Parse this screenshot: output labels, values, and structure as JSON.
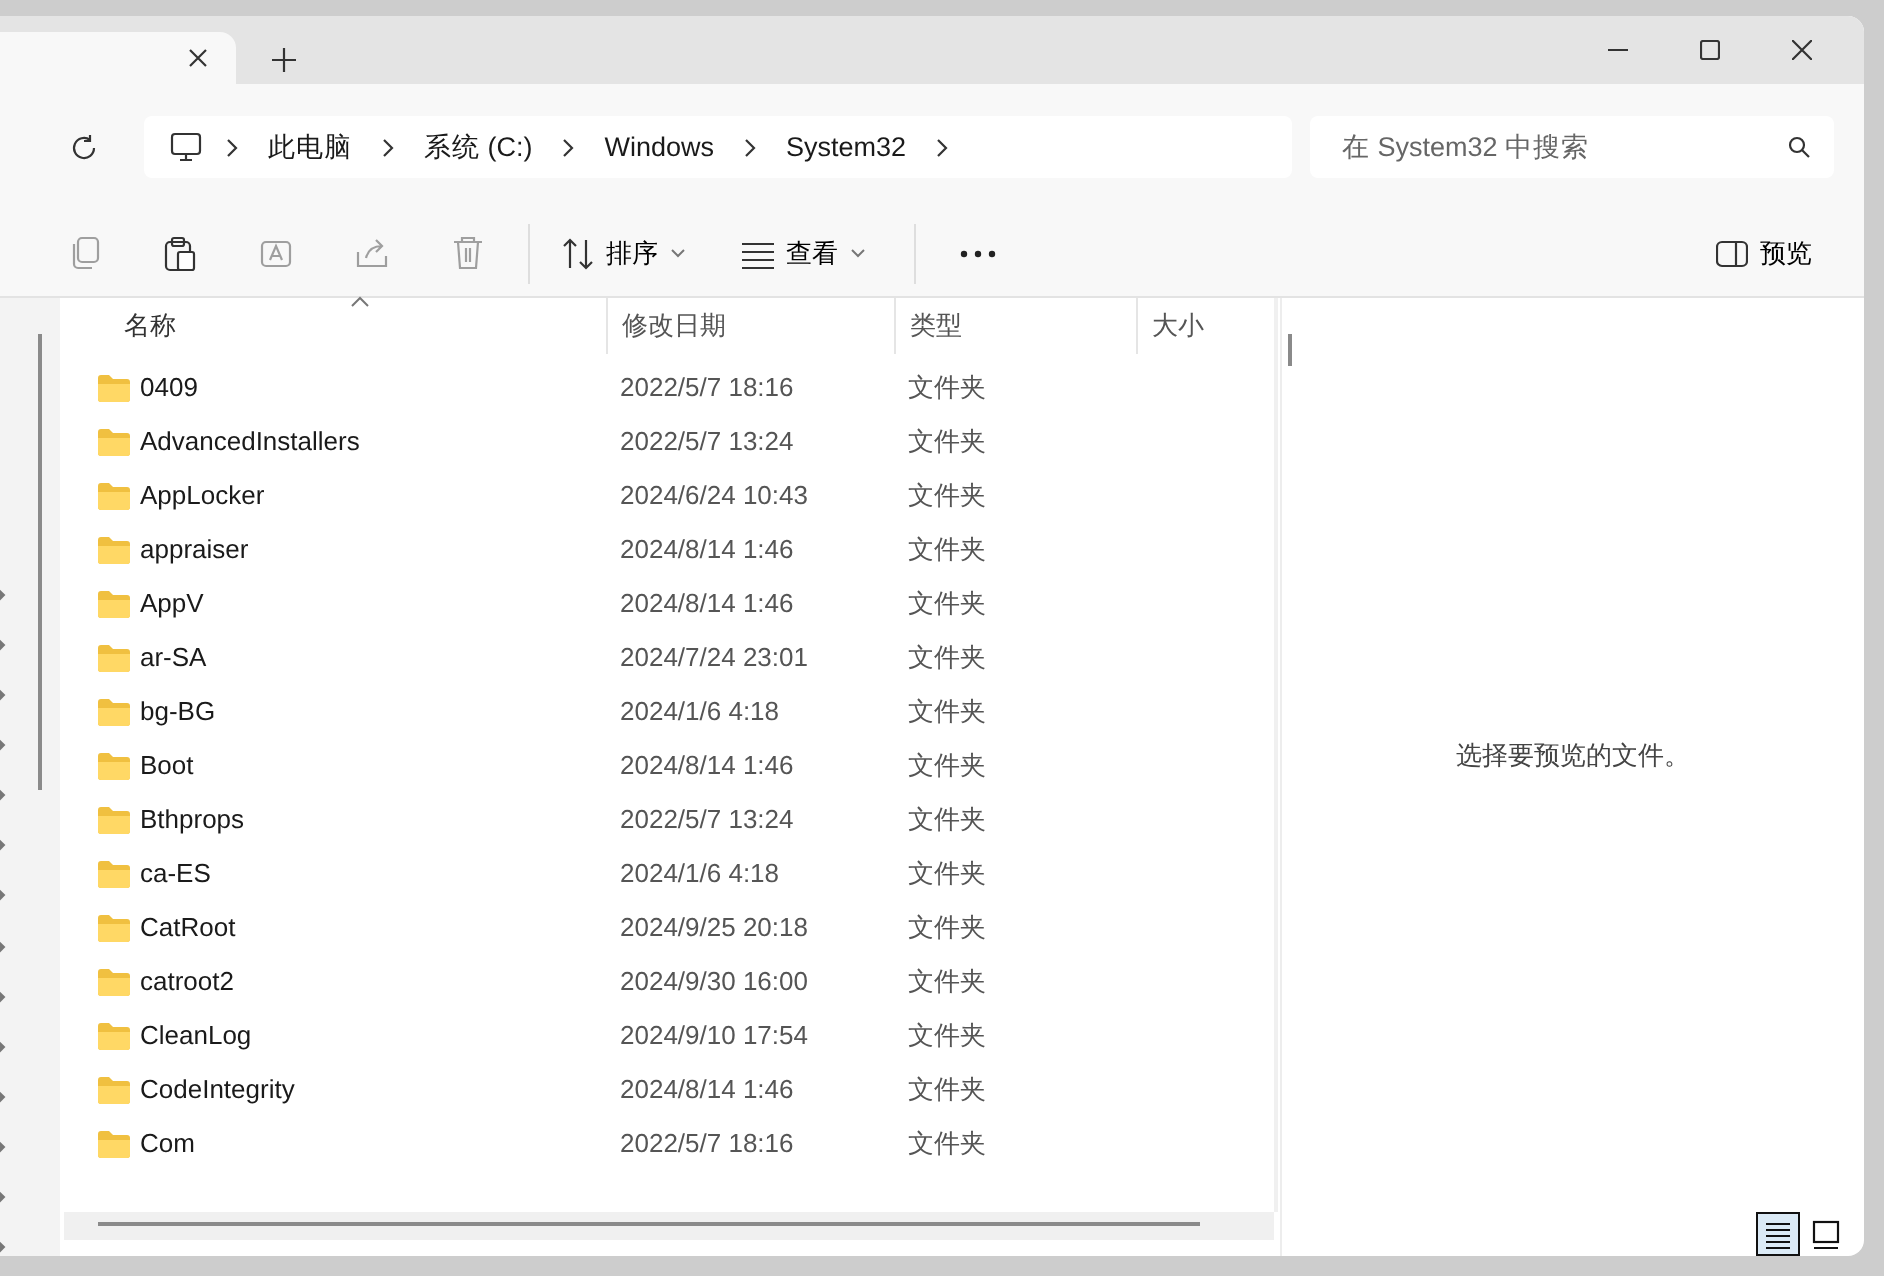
{
  "tabs": [
    {
      "selected": true
    }
  ],
  "address": {
    "crumbs": [
      "此电脑",
      "系统 (C:)",
      "Windows",
      "System32"
    ]
  },
  "search": {
    "placeholder": "在 System32 中搜索"
  },
  "toolbar": {
    "actions": [
      {
        "kind": "copy",
        "disabled": true
      },
      {
        "kind": "paste",
        "disabled": false
      },
      {
        "kind": "rename",
        "disabled": true
      },
      {
        "kind": "share",
        "disabled": true
      },
      {
        "kind": "delete",
        "disabled": true
      }
    ],
    "menus": [
      {
        "kind": "sort",
        "label": "排序"
      },
      {
        "kind": "view",
        "label": "查看"
      }
    ],
    "preview": {
      "label": "预览"
    }
  },
  "table": {
    "columns": [
      {
        "label": "名称",
        "sorted": true
      },
      {
        "label": "修改日期",
        "sorted": false
      },
      {
        "label": "类型",
        "sorted": false
      },
      {
        "label": "大小",
        "sorted": false
      }
    ],
    "rows": [
      {
        "name": "0409",
        "date": "2022/5/7 18:16",
        "type": "文件夹"
      },
      {
        "name": "AdvancedInstallers",
        "date": "2022/5/7 13:24",
        "type": "文件夹"
      },
      {
        "name": "AppLocker",
        "date": "2024/6/24 10:43",
        "type": "文件夹"
      },
      {
        "name": "appraiser",
        "date": "2024/8/14 1:46",
        "type": "文件夹"
      },
      {
        "name": "AppV",
        "date": "2024/8/14 1:46",
        "type": "文件夹"
      },
      {
        "name": "ar-SA",
        "date": "2024/7/24 23:01",
        "type": "文件夹"
      },
      {
        "name": "bg-BG",
        "date": "2024/1/6 4:18",
        "type": "文件夹"
      },
      {
        "name": "Boot",
        "date": "2024/8/14 1:46",
        "type": "文件夹"
      },
      {
        "name": "Bthprops",
        "date": "2022/5/7 13:24",
        "type": "文件夹"
      },
      {
        "name": "ca-ES",
        "date": "2024/1/6 4:18",
        "type": "文件夹"
      },
      {
        "name": "CatRoot",
        "date": "2024/9/25 20:18",
        "type": "文件夹"
      },
      {
        "name": "catroot2",
        "date": "2024/9/30 16:00",
        "type": "文件夹"
      },
      {
        "name": "CleanLog",
        "date": "2024/9/10 17:54",
        "type": "文件夹"
      },
      {
        "name": "CodeIntegrity",
        "date": "2024/8/14 1:46",
        "type": "文件夹"
      },
      {
        "name": "Com",
        "date": "2022/5/7 18:16",
        "type": "文件夹"
      }
    ]
  },
  "preview_pane": {
    "message": "选择要预览的文件。"
  },
  "view_buttons": [
    {
      "kind": "details",
      "selected": true
    },
    {
      "kind": "tiles",
      "selected": false
    }
  ]
}
